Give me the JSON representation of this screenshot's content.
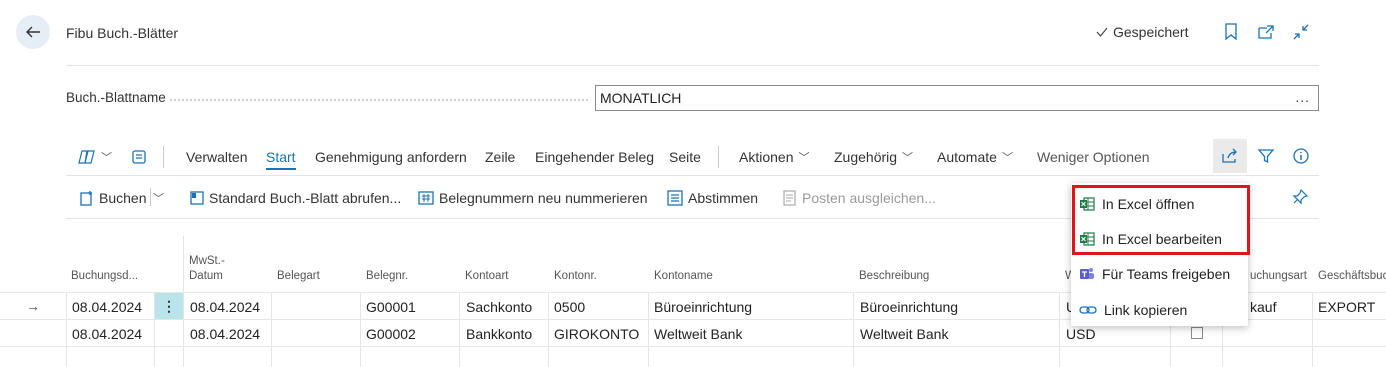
{
  "header": {
    "title": "Fibu Buch.-Blätter",
    "saved_label": "Gespeichert",
    "icons": [
      "back-arrow-icon",
      "bookmark-icon",
      "open-new-window-icon",
      "collapse-icon"
    ]
  },
  "field": {
    "label": "Buch.-Blattname",
    "value": "MONATLICH",
    "more": "..."
  },
  "tabs": {
    "verwalten": "Verwalten",
    "start": "Start",
    "genehmigung": "Genehmigung anfordern",
    "zeile": "Zeile",
    "eingehender": "Eingehender Beleg",
    "seite": "Seite",
    "aktionen": "Aktionen",
    "zugehoerig": "Zugehörig",
    "automate": "Automate",
    "weniger": "Weniger Optionen"
  },
  "actions": {
    "buchen": "Buchen",
    "standard": "Standard Buch.-Blatt abrufen...",
    "belegnummern": "Belegnummern neu nummerieren",
    "abstimmen": "Abstimmen",
    "posten": "Posten ausgleichen..."
  },
  "share_menu": {
    "items": [
      "In Excel öffnen",
      "In Excel bearbeiten",
      "Für Teams freigeben",
      "Link kopieren"
    ]
  },
  "table": {
    "columns": {
      "buchungsdatum": "Buchungsd...",
      "mwst_1": "MwSt.-",
      "mwst_2": "Datum",
      "belegart": "Belegart",
      "belegnr": "Belegnr.",
      "kontoart": "Kontoart",
      "kontonr": "Kontonr.",
      "kontoname": "Kontoname",
      "beschreibung": "Beschreibung",
      "w": "W",
      "buchungsart": "uchungsart",
      "geschaeft": "Geschäftsbuc"
    },
    "rows": [
      {
        "buchungsdatum": "08.04.2024",
        "mwst": "08.04.2024",
        "belegart": "",
        "belegnr": "G00001",
        "kontoart": "Sachkonto",
        "kontonr": "0500",
        "kontoname": "Büroeinrichtung",
        "beschreibung": "Büroeinrichtung",
        "waehrung": "U",
        "buchungsart": "kauf",
        "geschaeft": "EXPORT"
      },
      {
        "buchungsdatum": "08.04.2024",
        "mwst": "08.04.2024",
        "belegart": "",
        "belegnr": "G00002",
        "kontoart": "Bankkonto",
        "kontonr": "GIROKONTO",
        "kontoname": "Weltweit Bank",
        "beschreibung": "Weltweit Bank",
        "waehrung": "USD",
        "buchungsart": "",
        "geschaeft": ""
      }
    ]
  },
  "colors": {
    "accent": "#1b72b5",
    "highlight_border": "#e0151c",
    "excel_green": "#1d7a44",
    "teams_purple": "#5b5fc7",
    "selected_cell": "#b9e4ea"
  }
}
